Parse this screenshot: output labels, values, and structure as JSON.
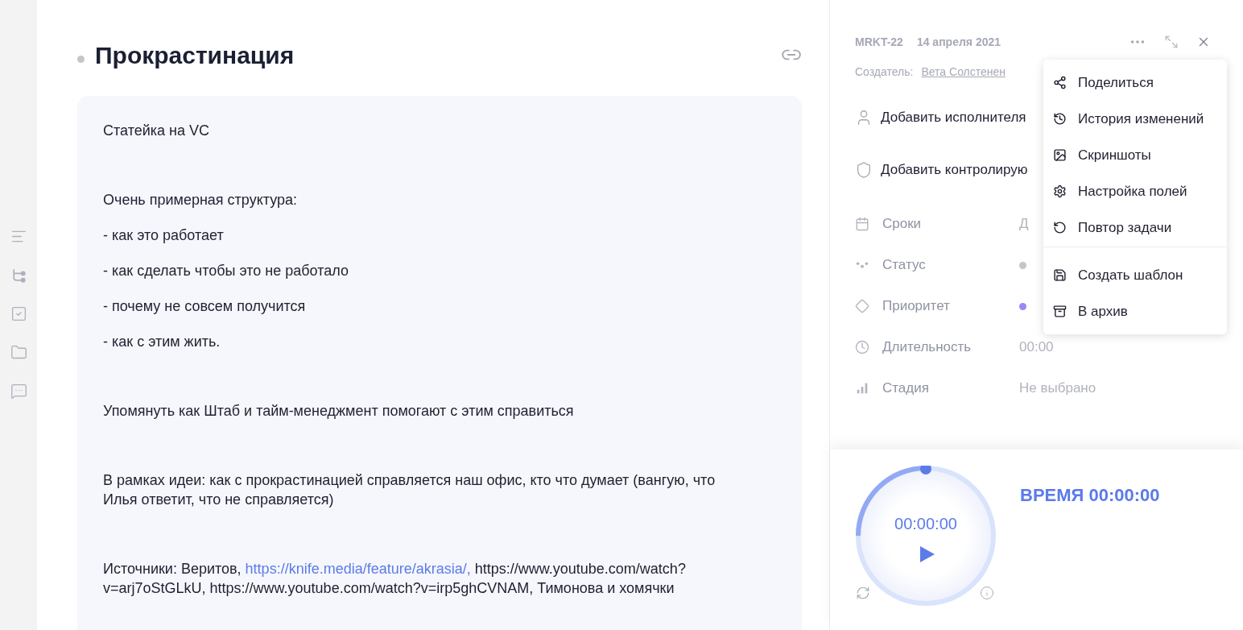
{
  "rail": {
    "items": [
      {
        "kind": "description"
      },
      {
        "kind": "subtasks"
      },
      {
        "kind": "checklist"
      },
      {
        "kind": "files"
      },
      {
        "kind": "comments"
      }
    ]
  },
  "task": {
    "title": "Прокрастинация",
    "blocks": [
      {
        "kind": "paragraph",
        "text": "Статейка на VC"
      },
      {
        "kind": "paragraph",
        "text": "Очень примерная структура:"
      },
      {
        "kind": "list_item",
        "text": "- как это работает"
      },
      {
        "kind": "list_item",
        "text": "- как сделать чтобы это не работало"
      },
      {
        "kind": "list_item",
        "text": "- почему не совсем получится"
      },
      {
        "kind": "list_item",
        "text": "- как с этим жить."
      },
      {
        "kind": "paragraph",
        "text": "Упомянуть как Штаб и тайм-менеджмент помогают с этим справиться"
      },
      {
        "kind": "paragraph",
        "text": "В рамках идеи: как с прокрастинацией справляется наш офис, кто что думает (вангую, что Илья ответит, что не справляется)"
      },
      {
        "kind": "paragraph",
        "text": "Источники: Веритов, ",
        "link": "https://knife.media/feature/akrasia/,",
        "after": " https://www.youtube.com/watch?v=arj7oStGLkU, https://www.youtube.com/watch?v=irp5ghCVNAM, Тимонова и хомячки"
      }
    ]
  },
  "details": {
    "id": "MRKT-22",
    "date": "14 апреля 2021",
    "creator_label": "Создатель:",
    "creator": "Вета Солстенен",
    "actions": [
      {
        "kind": "assignee",
        "text": "Добавить исполнителя"
      },
      {
        "kind": "controller",
        "text": "Добавить контролирую"
      }
    ],
    "fields": [
      {
        "kind": "dates",
        "label": "Сроки",
        "value": "Д"
      },
      {
        "kind": "status",
        "label": "Статус",
        "color": "#c4c6cc"
      },
      {
        "kind": "priority",
        "label": "Приоритет",
        "color": "#9b87f5"
      },
      {
        "kind": "duration",
        "label": "Длительность",
        "value": "00:00"
      },
      {
        "kind": "stage",
        "label": "Стадия",
        "value": "Не выбрано"
      }
    ]
  },
  "menu": {
    "groups": [
      [
        {
          "kind": "share",
          "label": "Поделиться"
        },
        {
          "kind": "history",
          "label": "История изменений"
        },
        {
          "kind": "screenshots",
          "label": "Скриншоты"
        },
        {
          "kind": "settings",
          "label": "Настройка полей"
        },
        {
          "kind": "repeat",
          "label": "Повтор задачи"
        }
      ],
      [
        {
          "kind": "template",
          "label": "Создать шаблон"
        },
        {
          "kind": "archive",
          "label": "В архив"
        }
      ]
    ]
  },
  "timer": {
    "clock": "00:00:00",
    "total": "ВРЕМЯ 00:00:00"
  }
}
